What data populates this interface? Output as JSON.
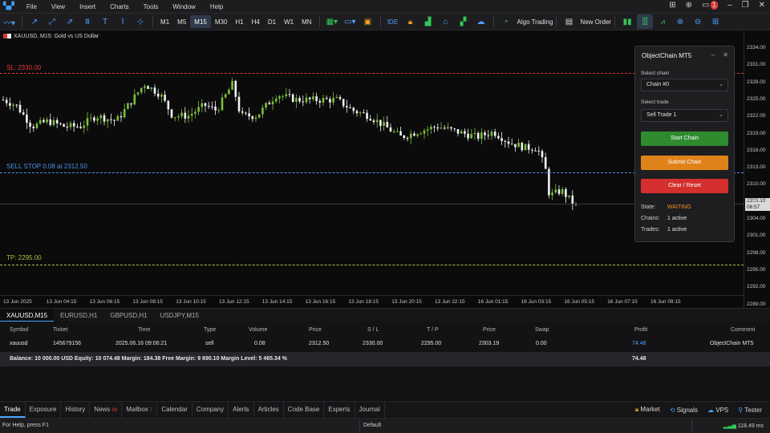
{
  "menu": [
    "File",
    "View",
    "Insert",
    "Charts",
    "Tools",
    "Window",
    "Help"
  ],
  "toolbar": {
    "timeframes": [
      "M1",
      "M5",
      "M15",
      "M30",
      "H1",
      "H4",
      "D1",
      "W1",
      "MN"
    ],
    "active_timeframe": "M15",
    "ide_label": "IDE",
    "algo_label": "Algo Trading",
    "new_order_label": "New Order",
    "notif_count": "1"
  },
  "chart": {
    "title": "XAUUSD, M15:  Gold vs US Dollar",
    "sl_label": "SL: 2330.00",
    "sell_stop_label": "SELL STOP 0.08 at 2312.50",
    "tp_label": "TP: 2295.00",
    "current_price": "2303.19",
    "current_time": "08:57",
    "price_ticks": [
      "2334.00",
      "2331.00",
      "2328.00",
      "2325.00",
      "2322.00",
      "2319.00",
      "2316.00",
      "2313.00",
      "2310.00",
      "2307.00",
      "2304.00",
      "2301.00",
      "2298.00",
      "2295.00",
      "2292.00",
      "2289.00"
    ],
    "time_ticks": [
      "13 Jun 2025",
      "13 Jun 04:15",
      "13 Jun 06:15",
      "13 Jun 08:15",
      "13 Jun 10:15",
      "13 Jun 12:15",
      "13 Jun 14:15",
      "13 Jun 16:15",
      "13 Jun 18:15",
      "13 Jun 20:15",
      "13 Jun 22:15",
      "16 Jun 01:15",
      "16 Jun 03:15",
      "16 Jun 05:15",
      "16 Jun 07:15",
      "16 Jun 09:15"
    ],
    "colors": {
      "sl": "#e53935",
      "sell_stop": "#4a8fe0",
      "tp": "#a6c23a",
      "bull": "#7bbf3a",
      "bear": "#f2f2f2"
    }
  },
  "panel": {
    "title": "ObjectChain MT5",
    "select_chain_label": "Select chain",
    "chain_value": "Chain #0",
    "select_trade_label": "Select trade",
    "trade_value": "Sell Trade 1",
    "start_label": "Start Chain",
    "submit_label": "Submit Chain",
    "clear_label": "Clear / Reset",
    "state_key": "State:",
    "state_value": "WAITING",
    "chains_key": "Chains:",
    "chains_value": "1 active",
    "trades_key": "Trades:",
    "trades_value": "1 active",
    "colors": {
      "start": "#2e8b2e",
      "submit": "#e0821a",
      "clear": "#d32f2f",
      "waiting": "#f0902a"
    }
  },
  "symbol_tabs": [
    "XAUUSD,M15",
    "EURUSD,H1",
    "GBPUSD,H1",
    "USDJPY,M15"
  ],
  "table": {
    "headers": [
      "Symbol",
      "Ticket",
      "Time",
      "Type",
      "Volume",
      "Price",
      "S / L",
      "T / P",
      "Price",
      "Swap",
      "Profit",
      "Comment"
    ],
    "row": [
      "xauusd",
      "145679156",
      "2025.06.16 09:06:21",
      "sell",
      "0.08",
      "2312.50",
      "2330.00",
      "2295.00",
      "2303.19",
      "0.00",
      "74.48",
      "ObjectChain MT5"
    ],
    "balance_line": "Balance: 10 000.00  USD   Equity: 10 074.48   Margin: 184.38   Free Margin: 9 890.10   Margin Level: 5 465.34 %",
    "total_profit": "74.48"
  },
  "bottom_tabs": [
    {
      "label": "Trade",
      "count": ""
    },
    {
      "label": "Exposure",
      "count": ""
    },
    {
      "label": "History",
      "count": ""
    },
    {
      "label": "News",
      "count": "99"
    },
    {
      "label": "Mailbox",
      "count": "7"
    },
    {
      "label": "Calendar",
      "count": ""
    },
    {
      "label": "Company",
      "count": ""
    },
    {
      "label": "Alerts",
      "count": ""
    },
    {
      "label": "Articles",
      "count": ""
    },
    {
      "label": "Code Base",
      "count": ""
    },
    {
      "label": "Experts",
      "count": ""
    },
    {
      "label": "Journal",
      "count": ""
    }
  ],
  "right_tabs": [
    "Market",
    "Signals",
    "VPS",
    "Tester"
  ],
  "status": {
    "help": "For Help, press F1",
    "profile": "Default",
    "ping": "118.49 ms"
  }
}
